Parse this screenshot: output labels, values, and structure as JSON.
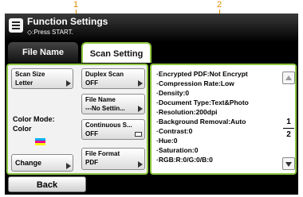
{
  "callouts": [
    "1",
    "2"
  ],
  "header": {
    "title": "Function Settings",
    "subtitle": "◇:Press START."
  },
  "tabs": [
    "File Name",
    "Scan Setting"
  ],
  "left_panel": {
    "scan_size": {
      "label": "Scan Size",
      "value": "Letter"
    },
    "color_mode": {
      "label": "Color Mode:",
      "value": "Color"
    },
    "change_label": "Change",
    "duplex_scan": {
      "label": "Duplex Scan",
      "value": "OFF"
    },
    "file_name": {
      "label": "File Name",
      "value": "---No Settin..."
    },
    "continuous_scan": {
      "label": "Continuous S...",
      "value": "OFF"
    },
    "file_format": {
      "label": "File Format",
      "value": "PDF"
    }
  },
  "right_panel": {
    "settings": [
      "·Encrypted PDF:Not Encrypt",
      "·Compression Rate:Low",
      "·Density:0",
      "·Document Type:Text&Photo",
      "·Resolution:200dpi",
      "·Background Removal:Auto",
      "·Contrast:0",
      "·Hue:0",
      "·Saturation:0",
      "·RGB:R:0/G:0/B:0"
    ],
    "page_current": "1",
    "page_total": "2"
  },
  "back_label": "Back",
  "colors": {
    "accent_green": "#8cc63f",
    "callout": "#e08a00",
    "color_chip": [
      "#00aeef",
      "#ec008c",
      "#fff200"
    ]
  }
}
